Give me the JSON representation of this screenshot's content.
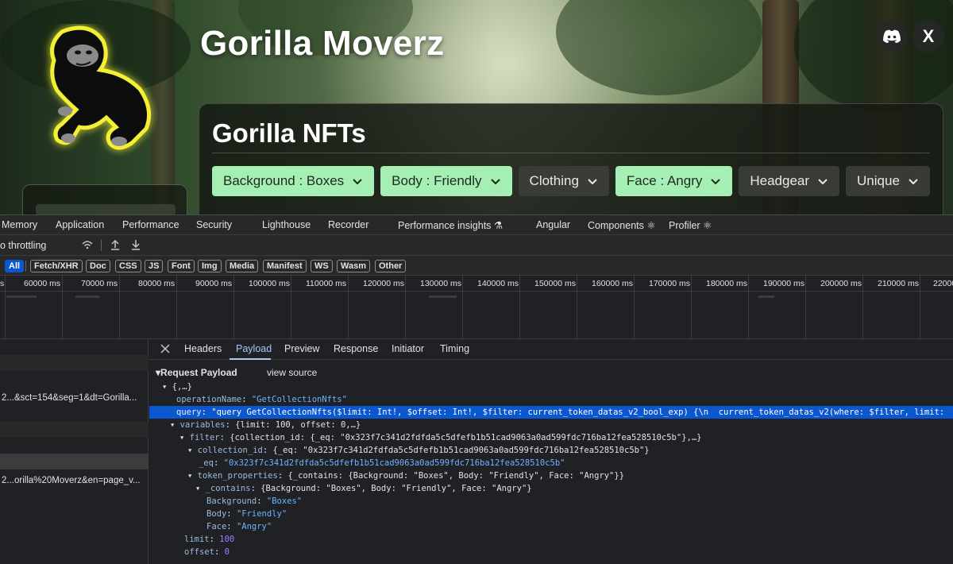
{
  "site": {
    "title": "Gorilla Moverz",
    "panel_title": "Gorilla NFTs",
    "filters": [
      {
        "label": "Background : Boxes",
        "active": true
      },
      {
        "label": "Body : Friendly",
        "active": true
      },
      {
        "label": "Clothing",
        "active": false
      },
      {
        "label": "Face : Angry",
        "active": true
      },
      {
        "label": "Headgear",
        "active": false
      },
      {
        "label": "Unique",
        "active": false
      }
    ],
    "social_x": "X"
  },
  "devtools": {
    "tabs": [
      "Memory",
      "Application",
      "Performance",
      "Security",
      "Lighthouse",
      "Recorder",
      "Performance insights ⚗",
      "Angular",
      "Components ⚛",
      "Profiler ⚛"
    ],
    "throttling": "o throttling",
    "type_filters": [
      "All",
      "Fetch/XHR",
      "Doc",
      "CSS",
      "JS",
      "Font",
      "Img",
      "Media",
      "Manifest",
      "WS",
      "Wasm",
      "Other"
    ],
    "selected_type": "All",
    "timeline_ticks": [
      "s",
      "60000 ms",
      "70000 ms",
      "80000 ms",
      "90000 ms",
      "100000 ms",
      "110000 ms",
      "120000 ms",
      "130000 ms",
      "140000 ms",
      "150000 ms",
      "160000 ms",
      "170000 ms",
      "180000 ms",
      "190000 ms",
      "200000 ms",
      "210000 ms",
      "22000"
    ],
    "requests": [
      {
        "name": "",
        "style": ""
      },
      {
        "name": "",
        "style": "alt"
      },
      {
        "name": "2...&sct=154&seg=1&dt=Gorilla...",
        "style": ""
      },
      {
        "name": "",
        "style": ""
      },
      {
        "name": "",
        "style": "alt"
      },
      {
        "name": "",
        "style": ""
      },
      {
        "name": "",
        "style": "sel"
      },
      {
        "name": "2...orilla%20Moverz&en=page_v...",
        "style": ""
      }
    ],
    "detail_tabs": [
      "Headers",
      "Payload",
      "Preview",
      "Response",
      "Initiator",
      "Timing"
    ],
    "active_detail_tab": "Payload",
    "payload_heading": "▾Request Payload",
    "view_source": "view source",
    "tree": {
      "root": "▾ {,…}",
      "operation_key": "operationName",
      "operation_val": "\"GetCollectionNfts\"",
      "query_key": "query",
      "query_val": "\"query GetCollectionNfts($limit: Int!, $offset: Int!, $filter: current_token_datas_v2_bool_exp) {\\n  current_token_datas_v2(where: $filter, limit:",
      "variables_key": "variables",
      "variables_val": "{limit: 100, offset: 0,…}",
      "filter_key": "filter",
      "filter_val": "{collection_id: {_eq: \"0x323f7c341d2fdfda5c5dfefb1b51cad9063a0ad599fdc716ba12fea528510c5b\"},…}",
      "collection_key": "collection_id",
      "collection_val": "{_eq: \"0x323f7c341d2fdfda5c5dfefb1b51cad9063a0ad599fdc716ba12fea528510c5b\"}",
      "eq_key": "_eq",
      "eq_val": "\"0x323f7c341d2fdfda5c5dfefb1b51cad9063a0ad599fdc716ba12fea528510c5b\"",
      "token_props_key": "token_properties",
      "token_props_val": "{_contains: {Background: \"Boxes\", Body: \"Friendly\", Face: \"Angry\"}}",
      "contains_key": "_contains",
      "contains_val": "{Background: \"Boxes\", Body: \"Friendly\", Face: \"Angry\"}",
      "bg_key": "Background",
      "bg_val": "\"Boxes\"",
      "body_key": "Body",
      "body_val": "\"Friendly\"",
      "face_key": "Face",
      "face_val": "\"Angry\"",
      "limit_key": "limit",
      "limit_val": "100",
      "offset_key": "offset",
      "offset_val": "0"
    }
  }
}
